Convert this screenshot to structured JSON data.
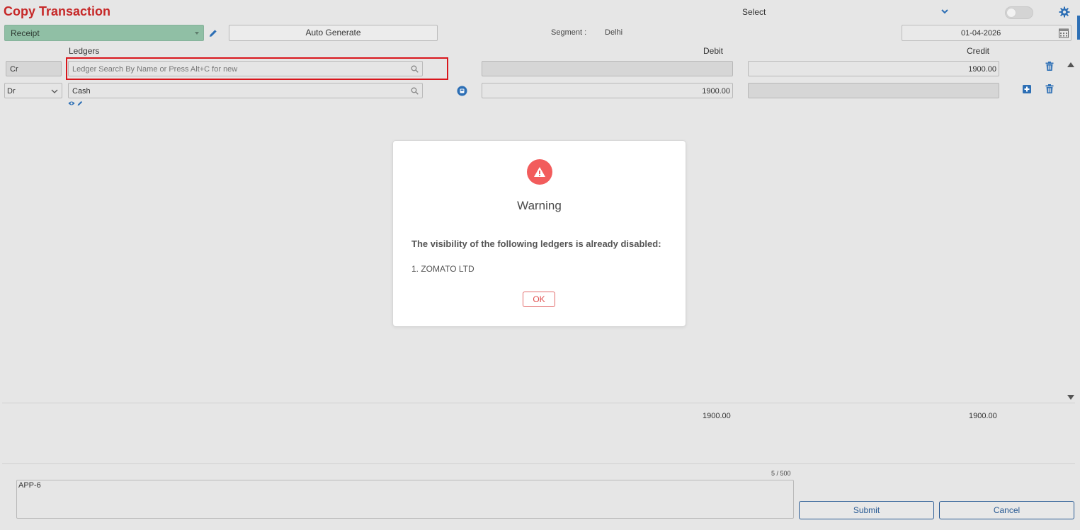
{
  "header": {
    "title": "Copy Transaction",
    "select_label": "Select"
  },
  "toolbar": {
    "voucher_type": "Receipt",
    "auto_generate_label": "Auto Generate",
    "segment_label": "Segment :",
    "segment_value": "Delhi",
    "date_value": "01-04-2026"
  },
  "columns": {
    "ledgers": "Ledgers",
    "debit": "Debit",
    "credit": "Credit"
  },
  "rows": [
    {
      "type": "Cr",
      "ledger_value": "",
      "ledger_placeholder": "Ledger Search By Name or Press Alt+C for new",
      "debit": "",
      "credit": "1900.00"
    },
    {
      "type": "Dr",
      "ledger_value": "Cash",
      "ledger_placeholder": "",
      "debit": "1900.00",
      "credit": ""
    }
  ],
  "totals": {
    "debit": "1900.00",
    "credit": "1900.00"
  },
  "narration": {
    "value": "APP-6",
    "counter": "5 / 500"
  },
  "footer": {
    "submit_label": "Submit",
    "cancel_label": "Cancel"
  },
  "modal": {
    "title": "Warning",
    "message": "The visibility of the following ledgers is already disabled:",
    "item": "1. ZOMATO LTD",
    "ok_label": "OK"
  },
  "icons": {
    "pencil": "pencil-icon",
    "search": "search-icon",
    "calendar": "calendar-icon",
    "gear": "gear-icon",
    "trash": "trash-icon",
    "plus": "plus-icon",
    "warning": "warning-icon",
    "eye": "eye-icon",
    "info": "info-icon"
  },
  "colors": {
    "title": "#c62828",
    "voucher_bg": "#90bfa5",
    "accent_blue": "#2d6fb5",
    "warning_red": "#f25c5c",
    "highlight_border": "#d9161c"
  }
}
